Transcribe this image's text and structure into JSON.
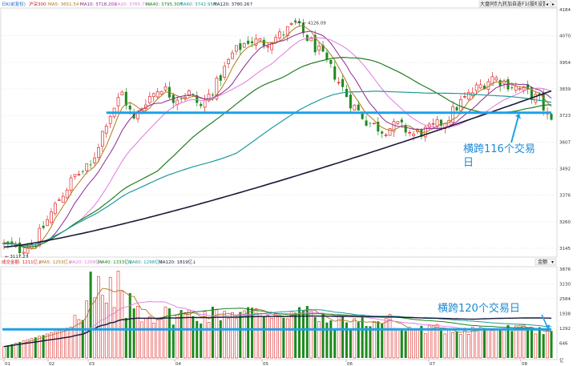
{
  "price_panel": {
    "legend": [
      {
        "text": "日K(前复权)",
        "color": "#1a6cc7"
      },
      {
        "text": "沪深300",
        "color": "#cc2222"
      },
      {
        "text": "MA5: 3651.54↑",
        "color": "#b0781c"
      },
      {
        "text": "MA10: 3718.20↓",
        "color": "#8e2a8e"
      },
      {
        "text": "MA20: 3765.79↓",
        "color": "#e07ae0"
      },
      {
        "text": "MA40: 3795.30↑",
        "color": "#1f7f1f"
      },
      {
        "text": "MA60: 3742.95↑",
        "color": "#1e9b9b"
      },
      {
        "text": "MA120: 3780.26↑",
        "color": "#1a1a3a"
      }
    ],
    "y_ticks": [
      "4184",
      "4070",
      "3954",
      "3839",
      "3723",
      "3607",
      "3492",
      "3376",
      "3260",
      "3145"
    ],
    "high_label": "4126.09",
    "low_label": "3117.27",
    "annotation": [
      "横跨116个交易",
      "日"
    ]
  },
  "volume_panel": {
    "legend": [
      {
        "text": "成交金额: 1211亿↓",
        "color": "#cc2222"
      },
      {
        "text": "MA5: 1253亿↓",
        "color": "#b0781c"
      },
      {
        "text": "MA20: 1209亿↓",
        "color": "#e07ae0"
      },
      {
        "text": "MA40: 1333亿↓",
        "color": "#1f7f1f"
      },
      {
        "text": "MA60: 1298亿↓",
        "color": "#1e9b9b"
      },
      {
        "text": "MA120: 1819亿↓",
        "color": "#1a1a3a"
      }
    ],
    "y_ticks": [
      "3876",
      "3230",
      "2584",
      "1938",
      "1292",
      "646"
    ],
    "unit_label": "亿",
    "annotation": "横跨120个交易日",
    "dropdown": "金额"
  },
  "x_axis": {
    "labels": [
      "01",
      "02",
      "03",
      "04",
      "05",
      "06",
      "07",
      "08"
    ]
  },
  "toolbar": [
    "大盘同列",
    "九转",
    "加自选",
    "F10",
    "股吧",
    "设置",
    "◂",
    "▸"
  ],
  "colors": {
    "up": "#e02828",
    "down": "#1e8a1e",
    "reference_line": "#1da1e8",
    "annotation": "#1c8ad6"
  },
  "chart_data": {
    "type": "candlestick",
    "title": "沪深300",
    "ylim": [
      3117,
      4184
    ],
    "volume_ylim": [
      0,
      3876
    ],
    "reference_level": 3735,
    "volume_reference_level": 1250,
    "high": 4126.09,
    "low": 3117.27
  }
}
